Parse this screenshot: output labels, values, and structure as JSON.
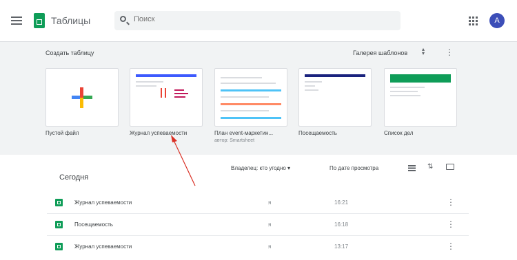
{
  "header": {
    "app_name": "Таблицы",
    "search_placeholder": "Поиск",
    "avatar_letter": "A"
  },
  "gallery": {
    "title": "Создать таблицу",
    "gallery_link": "Галерея шаблонов",
    "templates": [
      {
        "label": "Пустой файл",
        "sub": ""
      },
      {
        "label": "Журнал успеваемости",
        "sub": ""
      },
      {
        "label": "План event-маркетин...",
        "sub": "автор: Smartsheet"
      },
      {
        "label": "Посещаемость",
        "sub": ""
      },
      {
        "label": "Список дел",
        "sub": ""
      }
    ]
  },
  "recent": {
    "title": "Сегодня",
    "owner_filter": "Владелец: кто угодно ▾",
    "sort_label": "По дате просмотра",
    "files": [
      {
        "name": "Журнал успеваемости",
        "owner": "я",
        "time": "16:21"
      },
      {
        "name": "Посещаемость",
        "owner": "я",
        "time": "16:18"
      },
      {
        "name": "Журнал успеваемости",
        "owner": "я",
        "time": "13:17"
      }
    ]
  },
  "colors": {
    "brand_green": "#0f9d58",
    "annotation_arrow": "#d93025",
    "avatar": "#3c4eb8"
  }
}
